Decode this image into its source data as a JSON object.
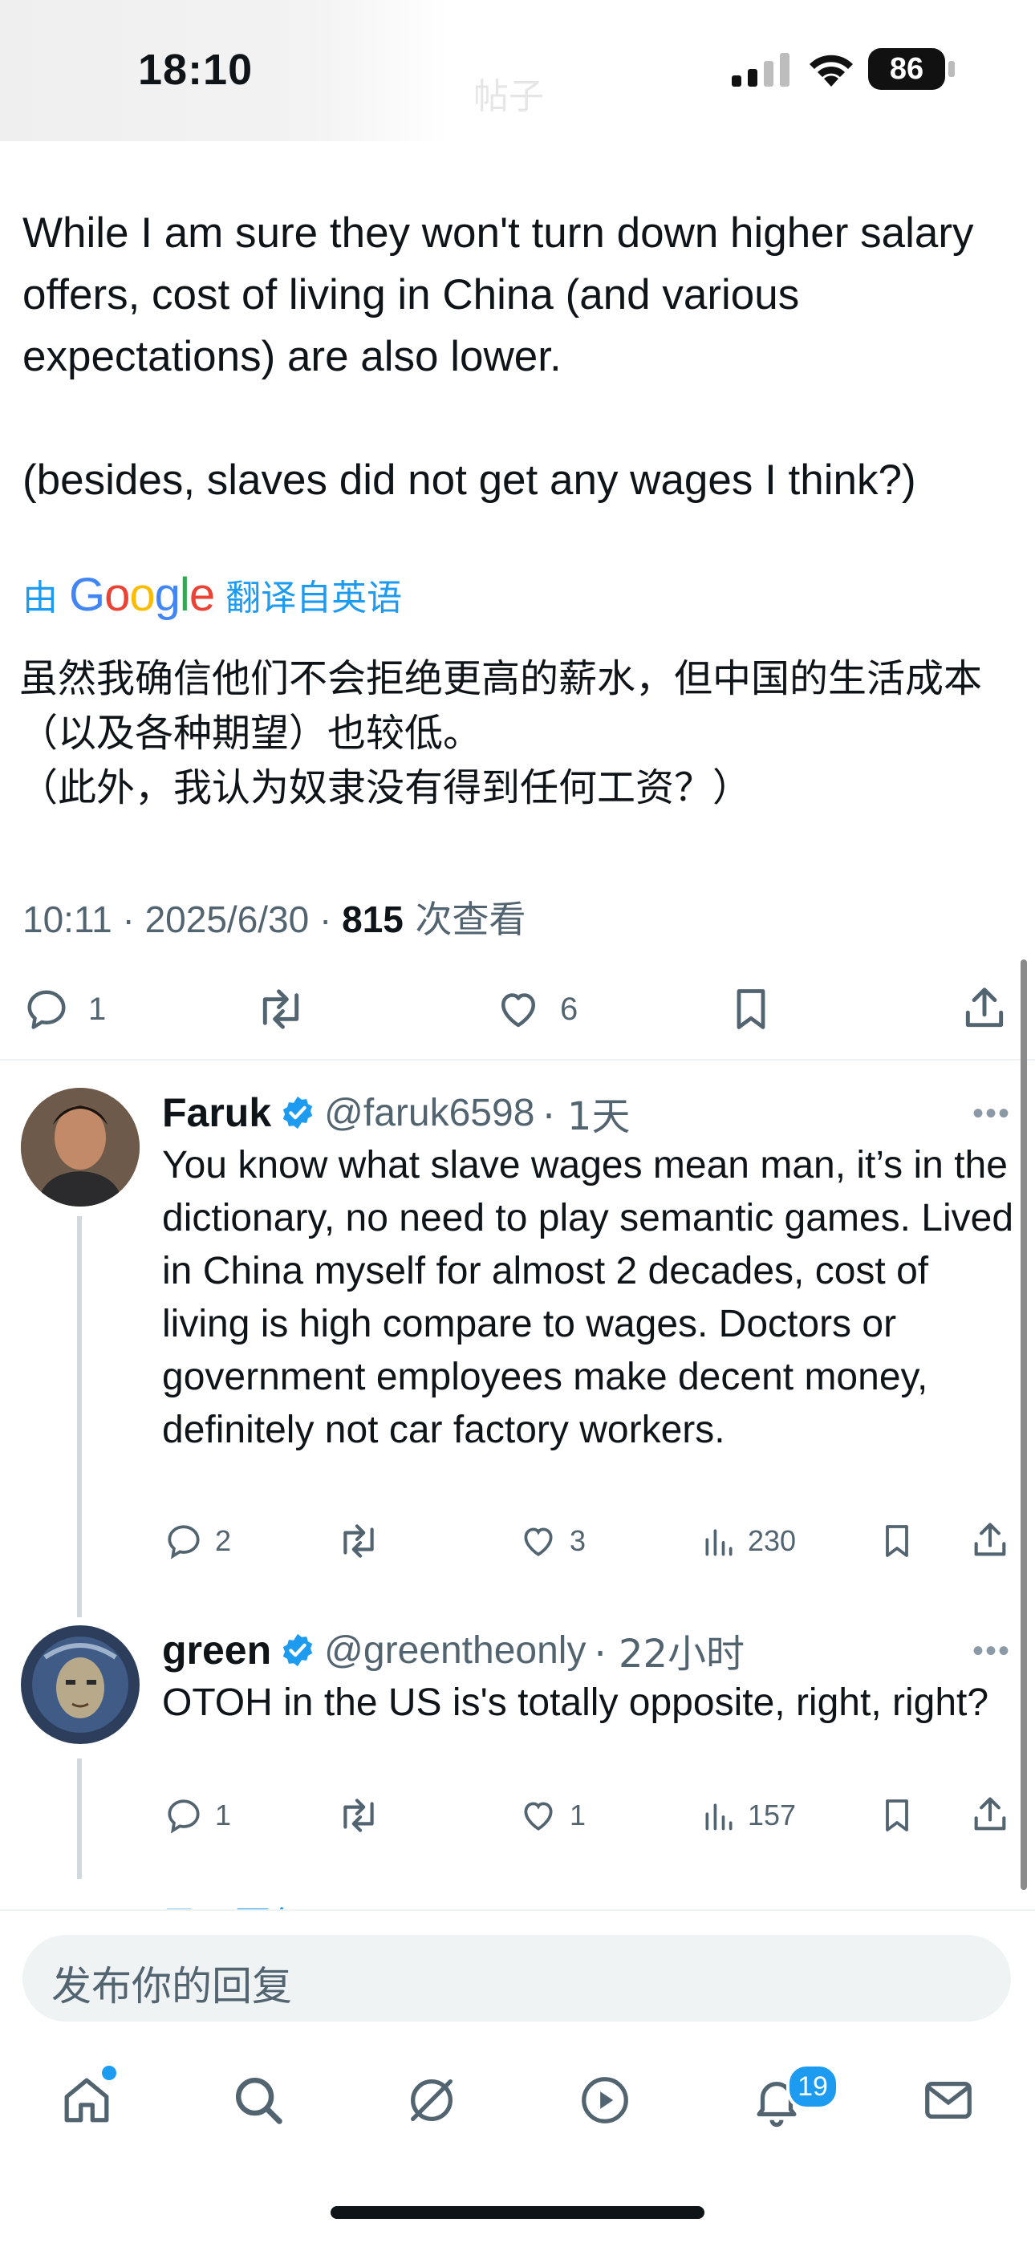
{
  "status_bar": {
    "time": "18:10",
    "battery": "86",
    "ghost_title": "帖子"
  },
  "tweet": {
    "text_en_1": "While I am sure they won't turn down higher salary offers, cost of living in China (and various expectations) are also lower.",
    "text_en_2": "(besides, slaves did not get any wages I think?)",
    "translate_prefix": "由",
    "translate_brand": "Google",
    "translate_suffix": "翻译自英语",
    "text_zh_1": "虽然我确信他们不会拒绝更高的薪水，但中国的生活成本（以及各种期望）也较低。",
    "text_zh_2": "（此外，我认为奴隶没有得到任何工资？）",
    "meta_time": "10:11 · 2025/6/30 · ",
    "views_count": "815",
    "views_label": " 次查看",
    "replies": "1",
    "likes": "6"
  },
  "replies": [
    {
      "name": "Faruk",
      "handle": "@faruk6598",
      "time": "· 1天",
      "text": "You know what slave wages mean man, it’s in the dictionary, no need to play semantic games. Lived in China myself for almost 2 decades, cost of living is high compare to wages. Doctors or government employees make decent money, definitely not car factory workers.",
      "replies": "2",
      "likes": "3",
      "views": "230"
    },
    {
      "name": "green",
      "handle": "@greentheonly",
      "time": "· 22小时",
      "text": "OTOH in the US is's totally opposite, right, right?",
      "replies": "1",
      "likes": "1",
      "views": "157"
    }
  ],
  "show_more": "显示回复",
  "reply_placeholder": "发布你的回复",
  "tabbar": {
    "notifications_badge": "19"
  },
  "colors": {
    "accent": "#1d9bf0",
    "text": "#0f1419",
    "muted": "#536471"
  }
}
